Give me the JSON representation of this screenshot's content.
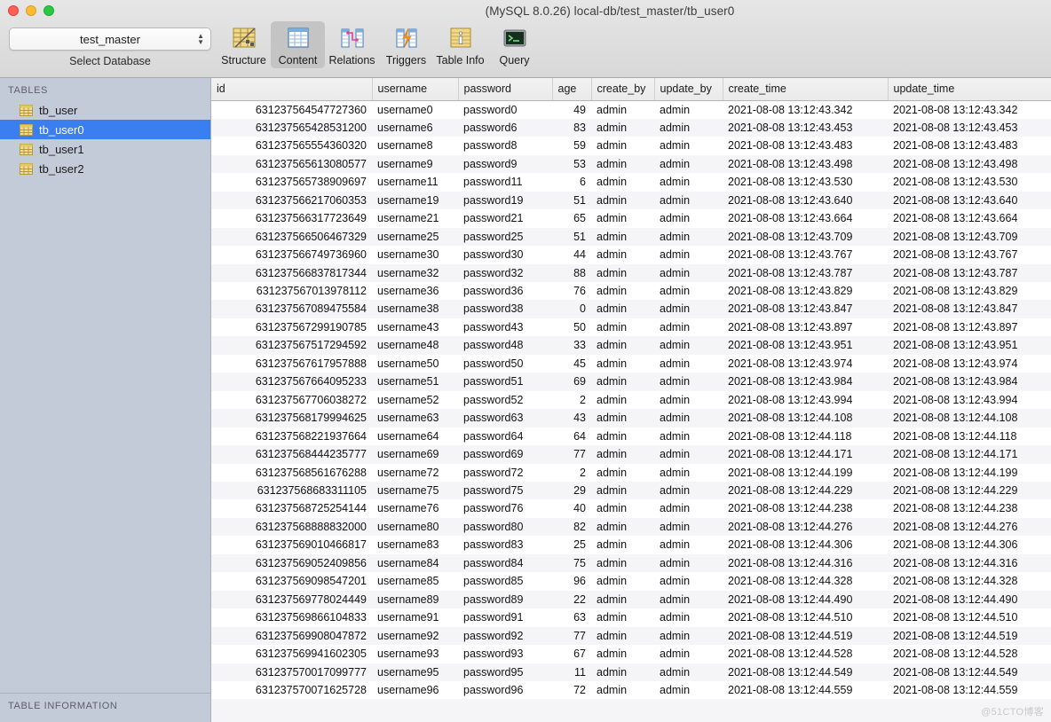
{
  "window": {
    "title": "(MySQL 8.0.26) local-db/test_master/tb_user0",
    "traffic_lights": [
      "close",
      "minimize",
      "maximize"
    ]
  },
  "database_selector": {
    "value": "test_master",
    "caption": "Select Database"
  },
  "toolbar": {
    "active": "Content",
    "items": [
      {
        "label": "Structure",
        "icon": "structure-icon"
      },
      {
        "label": "Content",
        "icon": "content-icon"
      },
      {
        "label": "Relations",
        "icon": "relations-icon"
      },
      {
        "label": "Triggers",
        "icon": "triggers-icon"
      },
      {
        "label": "Table Info",
        "icon": "table-info-icon"
      },
      {
        "label": "Query",
        "icon": "query-icon"
      }
    ]
  },
  "sidebar": {
    "header": "TABLES",
    "footer": "TABLE INFORMATION",
    "selected": "tb_user0",
    "items": [
      {
        "label": "tb_user"
      },
      {
        "label": "tb_user0"
      },
      {
        "label": "tb_user1"
      },
      {
        "label": "tb_user2"
      }
    ]
  },
  "accent_color": "#3b7ef0",
  "watermark": "@51CTO博客",
  "chart_data": {
    "type": "table",
    "title": "tb_user0 content",
    "columns": [
      "id",
      "username",
      "password",
      "age",
      "create_by",
      "update_by",
      "create_time",
      "update_time"
    ],
    "rows": [
      [
        "631237564547727360",
        "username0",
        "password0",
        "49",
        "admin",
        "admin",
        "2021-08-08 13:12:43.342",
        "2021-08-08 13:12:43.342"
      ],
      [
        "631237565428531200",
        "username6",
        "password6",
        "83",
        "admin",
        "admin",
        "2021-08-08 13:12:43.453",
        "2021-08-08 13:12:43.453"
      ],
      [
        "631237565554360320",
        "username8",
        "password8",
        "59",
        "admin",
        "admin",
        "2021-08-08 13:12:43.483",
        "2021-08-08 13:12:43.483"
      ],
      [
        "631237565613080577",
        "username9",
        "password9",
        "53",
        "admin",
        "admin",
        "2021-08-08 13:12:43.498",
        "2021-08-08 13:12:43.498"
      ],
      [
        "631237565738909697",
        "username11",
        "password11",
        "6",
        "admin",
        "admin",
        "2021-08-08 13:12:43.530",
        "2021-08-08 13:12:43.530"
      ],
      [
        "631237566217060353",
        "username19",
        "password19",
        "51",
        "admin",
        "admin",
        "2021-08-08 13:12:43.640",
        "2021-08-08 13:12:43.640"
      ],
      [
        "631237566317723649",
        "username21",
        "password21",
        "65",
        "admin",
        "admin",
        "2021-08-08 13:12:43.664",
        "2021-08-08 13:12:43.664"
      ],
      [
        "631237566506467329",
        "username25",
        "password25",
        "51",
        "admin",
        "admin",
        "2021-08-08 13:12:43.709",
        "2021-08-08 13:12:43.709"
      ],
      [
        "631237566749736960",
        "username30",
        "password30",
        "44",
        "admin",
        "admin",
        "2021-08-08 13:12:43.767",
        "2021-08-08 13:12:43.767"
      ],
      [
        "631237566837817344",
        "username32",
        "password32",
        "88",
        "admin",
        "admin",
        "2021-08-08 13:12:43.787",
        "2021-08-08 13:12:43.787"
      ],
      [
        "631237567013978112",
        "username36",
        "password36",
        "76",
        "admin",
        "admin",
        "2021-08-08 13:12:43.829",
        "2021-08-08 13:12:43.829"
      ],
      [
        "631237567089475584",
        "username38",
        "password38",
        "0",
        "admin",
        "admin",
        "2021-08-08 13:12:43.847",
        "2021-08-08 13:12:43.847"
      ],
      [
        "631237567299190785",
        "username43",
        "password43",
        "50",
        "admin",
        "admin",
        "2021-08-08 13:12:43.897",
        "2021-08-08 13:12:43.897"
      ],
      [
        "631237567517294592",
        "username48",
        "password48",
        "33",
        "admin",
        "admin",
        "2021-08-08 13:12:43.951",
        "2021-08-08 13:12:43.951"
      ],
      [
        "631237567617957888",
        "username50",
        "password50",
        "45",
        "admin",
        "admin",
        "2021-08-08 13:12:43.974",
        "2021-08-08 13:12:43.974"
      ],
      [
        "631237567664095233",
        "username51",
        "password51",
        "69",
        "admin",
        "admin",
        "2021-08-08 13:12:43.984",
        "2021-08-08 13:12:43.984"
      ],
      [
        "631237567706038272",
        "username52",
        "password52",
        "2",
        "admin",
        "admin",
        "2021-08-08 13:12:43.994",
        "2021-08-08 13:12:43.994"
      ],
      [
        "631237568179994625",
        "username63",
        "password63",
        "43",
        "admin",
        "admin",
        "2021-08-08 13:12:44.108",
        "2021-08-08 13:12:44.108"
      ],
      [
        "631237568221937664",
        "username64",
        "password64",
        "64",
        "admin",
        "admin",
        "2021-08-08 13:12:44.118",
        "2021-08-08 13:12:44.118"
      ],
      [
        "631237568444235777",
        "username69",
        "password69",
        "77",
        "admin",
        "admin",
        "2021-08-08 13:12:44.171",
        "2021-08-08 13:12:44.171"
      ],
      [
        "631237568561676288",
        "username72",
        "password72",
        "2",
        "admin",
        "admin",
        "2021-08-08 13:12:44.199",
        "2021-08-08 13:12:44.199"
      ],
      [
        "631237568683311105",
        "username75",
        "password75",
        "29",
        "admin",
        "admin",
        "2021-08-08 13:12:44.229",
        "2021-08-08 13:12:44.229"
      ],
      [
        "631237568725254144",
        "username76",
        "password76",
        "40",
        "admin",
        "admin",
        "2021-08-08 13:12:44.238",
        "2021-08-08 13:12:44.238"
      ],
      [
        "631237568888832000",
        "username80",
        "password80",
        "82",
        "admin",
        "admin",
        "2021-08-08 13:12:44.276",
        "2021-08-08 13:12:44.276"
      ],
      [
        "631237569010466817",
        "username83",
        "password83",
        "25",
        "admin",
        "admin",
        "2021-08-08 13:12:44.306",
        "2021-08-08 13:12:44.306"
      ],
      [
        "631237569052409856",
        "username84",
        "password84",
        "75",
        "admin",
        "admin",
        "2021-08-08 13:12:44.316",
        "2021-08-08 13:12:44.316"
      ],
      [
        "631237569098547201",
        "username85",
        "password85",
        "96",
        "admin",
        "admin",
        "2021-08-08 13:12:44.328",
        "2021-08-08 13:12:44.328"
      ],
      [
        "631237569778024449",
        "username89",
        "password89",
        "22",
        "admin",
        "admin",
        "2021-08-08 13:12:44.490",
        "2021-08-08 13:12:44.490"
      ],
      [
        "631237569866104833",
        "username91",
        "password91",
        "63",
        "admin",
        "admin",
        "2021-08-08 13:12:44.510",
        "2021-08-08 13:12:44.510"
      ],
      [
        "631237569908047872",
        "username92",
        "password92",
        "77",
        "admin",
        "admin",
        "2021-08-08 13:12:44.519",
        "2021-08-08 13:12:44.519"
      ],
      [
        "631237569941602305",
        "username93",
        "password93",
        "67",
        "admin",
        "admin",
        "2021-08-08 13:12:44.528",
        "2021-08-08 13:12:44.528"
      ],
      [
        "631237570017099777",
        "username95",
        "password95",
        "11",
        "admin",
        "admin",
        "2021-08-08 13:12:44.549",
        "2021-08-08 13:12:44.549"
      ],
      [
        "631237570071625728",
        "username96",
        "password96",
        "72",
        "admin",
        "admin",
        "2021-08-08 13:12:44.559",
        "2021-08-08 13:12:44.559"
      ]
    ]
  }
}
